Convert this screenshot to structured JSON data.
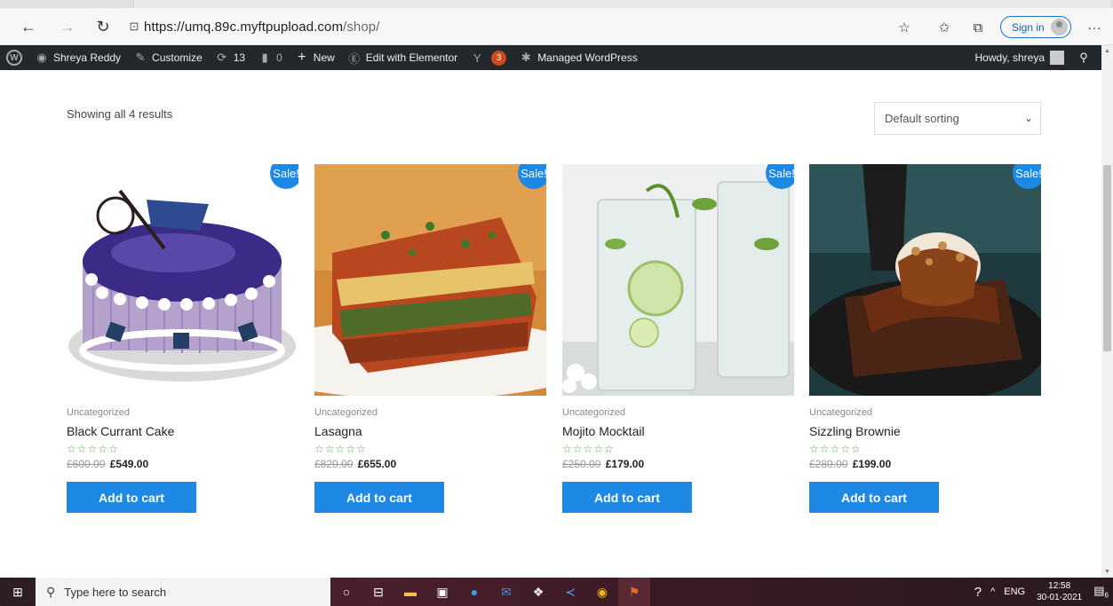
{
  "browser": {
    "url_host": "https://umq.89c.myftpupload.com",
    "url_path": "/shop/",
    "sign_in_label": "Sign in",
    "icons": [
      "back-icon",
      "forward-icon",
      "refresh-icon",
      "lock-icon",
      "favorite-add-icon",
      "favorites-icon",
      "collections-icon",
      "more-icon"
    ]
  },
  "adminbar": {
    "site_name": "Shreya Reddy",
    "customize": "Customize",
    "updates_count": "13",
    "comments_count": "0",
    "new_label": "New",
    "elementor_label": "Edit with Elementor",
    "yoast_badge": "3",
    "managed_label": "Managed WordPress",
    "howdy": "Howdy, shreya"
  },
  "shop": {
    "result_count": "Showing all 4 results",
    "sorting_selected": "Default sorting",
    "sale_label": "Sale!",
    "add_to_cart_label": "Add to cart",
    "stars": "☆☆☆☆☆",
    "products": [
      {
        "category": "Uncategorized",
        "title": "Black Currant Cake",
        "old_price": "£600.00",
        "price": "£549.00"
      },
      {
        "category": "Uncategorized",
        "title": "Lasagna",
        "old_price": "£820.00",
        "price": "£655.00"
      },
      {
        "category": "Uncategorized",
        "title": "Mojito Mocktail",
        "old_price": "£250.00",
        "price": "£179.00"
      },
      {
        "category": "Uncategorized",
        "title": "Sizzling Brownie",
        "old_price": "£280.00",
        "price": "£199.00"
      }
    ]
  },
  "taskbar": {
    "search_placeholder": "Type here to search",
    "language": "ENG",
    "time": "12:58",
    "date": "30-01-2021",
    "notifications": "6"
  }
}
